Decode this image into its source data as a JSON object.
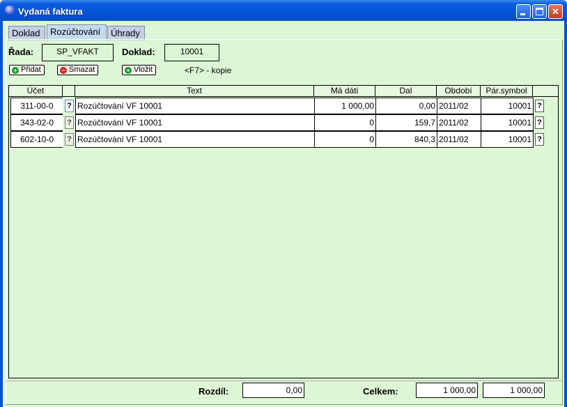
{
  "window": {
    "title": "Vydaná faktura",
    "accent": "#0554d6",
    "background": "#ddf6d6"
  },
  "tabs": [
    {
      "label": "Doklad",
      "active": false
    },
    {
      "label": "Rozúčtování",
      "active": true
    },
    {
      "label": "Úhrady",
      "active": false
    }
  ],
  "header": {
    "rada_label": "Řada:",
    "rada_value": "SP_VFAKT",
    "doklad_label": "Doklad:",
    "doklad_value": "10001"
  },
  "toolbar": {
    "add_label": "Přidat",
    "delete_label": "Smazat",
    "insert_label": "Vložit",
    "copy_hint": "<F7> - kopie",
    "add_icon": "plus-icon",
    "delete_icon": "minus-icon",
    "insert_icon": "plus-icon"
  },
  "grid": {
    "columns": [
      "Účet",
      "",
      "Text",
      "Má dáti",
      "Dal",
      "Období",
      "Pár.symbol",
      ""
    ],
    "lookup_label": "?",
    "rows": [
      {
        "ucet": "311-00-0",
        "text": "Rozúčtování VF 10001",
        "ma_dati": "1 000,00",
        "dal": "0,00",
        "obdobi": "2011/02",
        "par_symbol": "10001"
      },
      {
        "ucet": "343-02-0",
        "text": "Rozúčtování VF 10001",
        "ma_dati": "0",
        "dal": "159,7",
        "obdobi": "2011/02",
        "par_symbol": "10001"
      },
      {
        "ucet": "602-10-0",
        "text": "Rozúčtování VF 10001",
        "ma_dati": "0",
        "dal": "840,3",
        "obdobi": "2011/02",
        "par_symbol": "10001"
      }
    ]
  },
  "footer": {
    "rozdil_label": "Rozdíl:",
    "rozdil_value": "0,00",
    "celkem_label": "Celkem:",
    "celkem_ma_dati": "1 000,00",
    "celkem_dal": "1 000,00"
  }
}
